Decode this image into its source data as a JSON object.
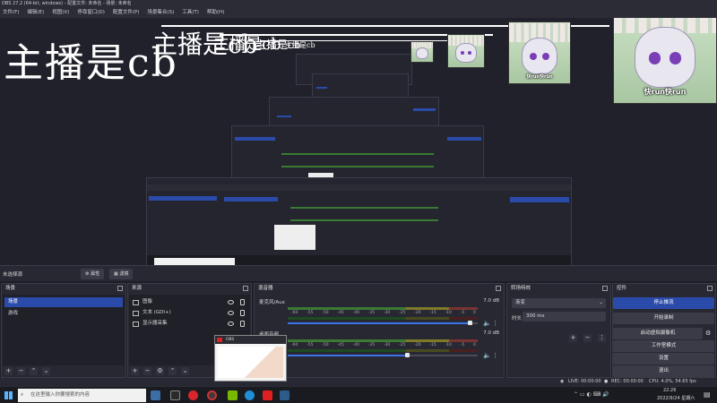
{
  "window": {
    "title": "OBS 27.2 (64-bit, windows) - 配置文件: 未命名 - 场景: 未命名"
  },
  "menu": [
    "文件(F)",
    "编辑(E)",
    "视图(V)",
    "停靠窗口(D)",
    "配置文件(P)",
    "场景集合(S)",
    "工具(T)",
    "帮助(H)"
  ],
  "preview": {
    "caption": "主播是cb",
    "thumbnail_label": "快run快run"
  },
  "scene_bar": {
    "label": "未选择源",
    "properties_button": "属性",
    "filters_button": "滤镜"
  },
  "scenes": {
    "title": "场景",
    "items": [
      "场景",
      "游戏"
    ],
    "selected_index": 0
  },
  "sources": {
    "title": "来源",
    "items": [
      {
        "name": "图像",
        "icon": "image-icon"
      },
      {
        "name": "文本 (GDI+)",
        "icon": "text-icon"
      },
      {
        "name": "显示器采集",
        "icon": "monitor-icon"
      }
    ]
  },
  "mixer": {
    "title": "混音器",
    "tracks": [
      {
        "name": "麦克风/Aux",
        "db": "7.0 dB",
        "volume": 0.95
      },
      {
        "name": "桌面音频",
        "db": "7.0 dB",
        "volume": 0.62
      }
    ],
    "ticks": [
      "-60",
      "-55",
      "-50",
      "-45",
      "-40",
      "-35",
      "-30",
      "-25",
      "-20",
      "-15",
      "-10",
      "-5",
      "0"
    ]
  },
  "transitions": {
    "title": "转场特效",
    "type": "渐变",
    "duration_label": "时长",
    "duration_value": "300 ms"
  },
  "controls": {
    "title": "控件",
    "buttons": [
      "停止推流",
      "开始录制",
      "启动虚拟摄像机",
      "工作室模式",
      "设置",
      "退出"
    ],
    "active_index": 0
  },
  "status": {
    "live": "LIVE: 00:00:00",
    "rec": "REC: 00:00:00",
    "cpu": "CPU: 4.0%, 54.65 fps"
  },
  "taskbar": {
    "search_placeholder": "在这里输入你要搜索的内容",
    "time": "22:26",
    "date": "2022/9/24 星期六",
    "popup_title": "OBS"
  },
  "colors": {
    "accent": "#2b4bab",
    "panel": "#272832",
    "background": "#1d1e26"
  }
}
